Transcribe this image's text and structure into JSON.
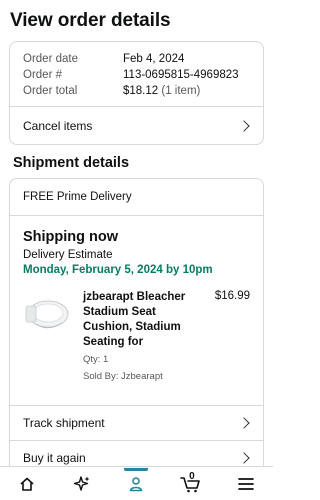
{
  "page": {
    "title": "View order details"
  },
  "order_summary": {
    "rows": [
      {
        "label": "Order date",
        "value": "Feb 4, 2024",
        "extra": ""
      },
      {
        "label": "Order #",
        "value": "113-0695815-4969823",
        "extra": ""
      },
      {
        "label": "Order total",
        "value": "$18.12",
        "extra": " (1 item)"
      }
    ],
    "cancel_label": "Cancel items"
  },
  "shipment": {
    "section_title": "Shipment details",
    "delivery_type": "FREE Prime Delivery",
    "status": "Shipping now",
    "estimate_label": "Delivery Estimate",
    "estimate_date": "Monday, February 5, 2024 by 10pm",
    "product": {
      "title": "jzbearapt Bleacher Stadium Seat Cushion, Stadium Seating for",
      "price": "$16.99",
      "qty": "Qty: 1",
      "sold_by": "Sold By: Jzbearapt"
    }
  },
  "actions": [
    {
      "label": "Track shipment"
    },
    {
      "label": "Buy it again"
    }
  ],
  "tabbar": {
    "items": [
      "home-icon",
      "ai-sparkle-icon",
      "account-icon",
      "cart-icon",
      "menu-icon"
    ],
    "active": "account-icon",
    "cart_count": "0"
  },
  "colors": {
    "accent_green": "#067d62",
    "active_tab": "#1f8a9e",
    "border": "#d5d9d9"
  }
}
